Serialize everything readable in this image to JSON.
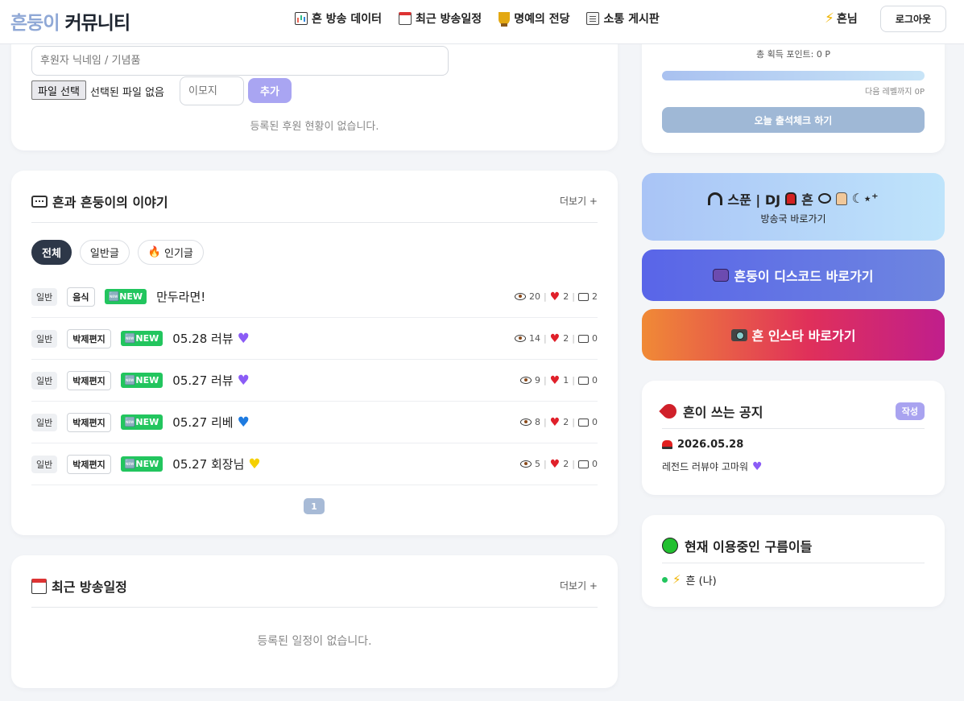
{
  "header": {
    "brand_accent": "흔둥이",
    "brand_rest": " 커뮤니티",
    "nav": [
      {
        "label": "흔 방송 데이터",
        "icon": "chart-icon"
      },
      {
        "label": "최근 방송일정",
        "icon": "calendar-icon"
      },
      {
        "label": "명예의 전당",
        "icon": "trophy-icon"
      },
      {
        "label": "소통 게시판",
        "icon": "board-icon"
      }
    ],
    "user_name": "흔님",
    "logout_label": "로그아웃"
  },
  "sponsor": {
    "name_placeholder": "후원자 닉네임 / 기념품",
    "file_button": "파일 선택",
    "file_status": "선택된 파일 없음",
    "emoji_placeholder": "이모지",
    "add_label": "추가",
    "empty": "등록된 후원 현황이 없습니다."
  },
  "stories": {
    "title": "흔과 흔둥이의 이야기",
    "more": "더보기 +",
    "tabs": [
      "전체",
      "일반글",
      "인기글"
    ],
    "posts": [
      {
        "cat": "일반",
        "sub": "음식",
        "new": "🆕NEW",
        "title": "만두라면!",
        "heart": "",
        "views": "20",
        "likes": "2",
        "comments": "2"
      },
      {
        "cat": "일반",
        "sub": "박제편지",
        "new": "🆕NEW",
        "title": "05.28 러뷰",
        "heart": "#8b5cf6",
        "views": "14",
        "likes": "2",
        "comments": "0"
      },
      {
        "cat": "일반",
        "sub": "박제편지",
        "new": "🆕NEW",
        "title": "05.27 러뷰",
        "heart": "#8b5cf6",
        "views": "9",
        "likes": "1",
        "comments": "0"
      },
      {
        "cat": "일반",
        "sub": "박제편지",
        "new": "🆕NEW",
        "title": "05.27 리베",
        "heart": "#1e7be0",
        "views": "8",
        "likes": "2",
        "comments": "0"
      },
      {
        "cat": "일반",
        "sub": "박제편지",
        "new": "🆕NEW",
        "title": "05.27 회장님",
        "heart": "#f5d000",
        "views": "5",
        "likes": "2",
        "comments": "0"
      }
    ],
    "page": "1"
  },
  "schedule": {
    "title": "최근 방송일정",
    "more": "더보기 +",
    "empty": "등록된 일정이 없습니다."
  },
  "points": {
    "total_label": "총 획득 포인트: 0 P",
    "progress": 0,
    "next_level": "다음 레벨까지 0P",
    "attend_label": "오늘 출석체크 하기"
  },
  "links": {
    "dj_main_prefix": "스푼 | DJ",
    "dj_main_mid": "흔",
    "dj_main_suffix": "☾⋆⁺",
    "dj_sub": "방송국 바로가기",
    "discord": "흔둥이 디스코드 바로가기",
    "instagram": "흔 인스타 바로가기"
  },
  "notice": {
    "title": "흔이 쓰는 공지",
    "write_label": "작성",
    "date": "2026.05.28",
    "body": "레전드 러뷰야 고마워"
  },
  "users": {
    "title": "현재 이용중인 구름이들",
    "list": [
      "흔 (나)"
    ]
  }
}
